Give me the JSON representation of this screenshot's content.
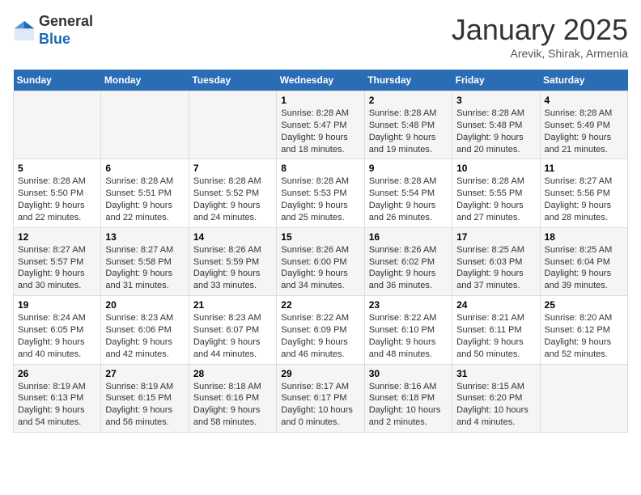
{
  "header": {
    "logo_line1": "General",
    "logo_line2": "Blue",
    "title": "January 2025",
    "subtitle": "Arevik, Shirak, Armenia"
  },
  "weekdays": [
    "Sunday",
    "Monday",
    "Tuesday",
    "Wednesday",
    "Thursday",
    "Friday",
    "Saturday"
  ],
  "weeks": [
    [
      {
        "day": null,
        "info": null
      },
      {
        "day": null,
        "info": null
      },
      {
        "day": null,
        "info": null
      },
      {
        "day": "1",
        "info": "Sunrise: 8:28 AM\nSunset: 5:47 PM\nDaylight: 9 hours\nand 18 minutes."
      },
      {
        "day": "2",
        "info": "Sunrise: 8:28 AM\nSunset: 5:48 PM\nDaylight: 9 hours\nand 19 minutes."
      },
      {
        "day": "3",
        "info": "Sunrise: 8:28 AM\nSunset: 5:48 PM\nDaylight: 9 hours\nand 20 minutes."
      },
      {
        "day": "4",
        "info": "Sunrise: 8:28 AM\nSunset: 5:49 PM\nDaylight: 9 hours\nand 21 minutes."
      }
    ],
    [
      {
        "day": "5",
        "info": "Sunrise: 8:28 AM\nSunset: 5:50 PM\nDaylight: 9 hours\nand 22 minutes."
      },
      {
        "day": "6",
        "info": "Sunrise: 8:28 AM\nSunset: 5:51 PM\nDaylight: 9 hours\nand 22 minutes."
      },
      {
        "day": "7",
        "info": "Sunrise: 8:28 AM\nSunset: 5:52 PM\nDaylight: 9 hours\nand 24 minutes."
      },
      {
        "day": "8",
        "info": "Sunrise: 8:28 AM\nSunset: 5:53 PM\nDaylight: 9 hours\nand 25 minutes."
      },
      {
        "day": "9",
        "info": "Sunrise: 8:28 AM\nSunset: 5:54 PM\nDaylight: 9 hours\nand 26 minutes."
      },
      {
        "day": "10",
        "info": "Sunrise: 8:28 AM\nSunset: 5:55 PM\nDaylight: 9 hours\nand 27 minutes."
      },
      {
        "day": "11",
        "info": "Sunrise: 8:27 AM\nSunset: 5:56 PM\nDaylight: 9 hours\nand 28 minutes."
      }
    ],
    [
      {
        "day": "12",
        "info": "Sunrise: 8:27 AM\nSunset: 5:57 PM\nDaylight: 9 hours\nand 30 minutes."
      },
      {
        "day": "13",
        "info": "Sunrise: 8:27 AM\nSunset: 5:58 PM\nDaylight: 9 hours\nand 31 minutes."
      },
      {
        "day": "14",
        "info": "Sunrise: 8:26 AM\nSunset: 5:59 PM\nDaylight: 9 hours\nand 33 minutes."
      },
      {
        "day": "15",
        "info": "Sunrise: 8:26 AM\nSunset: 6:00 PM\nDaylight: 9 hours\nand 34 minutes."
      },
      {
        "day": "16",
        "info": "Sunrise: 8:26 AM\nSunset: 6:02 PM\nDaylight: 9 hours\nand 36 minutes."
      },
      {
        "day": "17",
        "info": "Sunrise: 8:25 AM\nSunset: 6:03 PM\nDaylight: 9 hours\nand 37 minutes."
      },
      {
        "day": "18",
        "info": "Sunrise: 8:25 AM\nSunset: 6:04 PM\nDaylight: 9 hours\nand 39 minutes."
      }
    ],
    [
      {
        "day": "19",
        "info": "Sunrise: 8:24 AM\nSunset: 6:05 PM\nDaylight: 9 hours\nand 40 minutes."
      },
      {
        "day": "20",
        "info": "Sunrise: 8:23 AM\nSunset: 6:06 PM\nDaylight: 9 hours\nand 42 minutes."
      },
      {
        "day": "21",
        "info": "Sunrise: 8:23 AM\nSunset: 6:07 PM\nDaylight: 9 hours\nand 44 minutes."
      },
      {
        "day": "22",
        "info": "Sunrise: 8:22 AM\nSunset: 6:09 PM\nDaylight: 9 hours\nand 46 minutes."
      },
      {
        "day": "23",
        "info": "Sunrise: 8:22 AM\nSunset: 6:10 PM\nDaylight: 9 hours\nand 48 minutes."
      },
      {
        "day": "24",
        "info": "Sunrise: 8:21 AM\nSunset: 6:11 PM\nDaylight: 9 hours\nand 50 minutes."
      },
      {
        "day": "25",
        "info": "Sunrise: 8:20 AM\nSunset: 6:12 PM\nDaylight: 9 hours\nand 52 minutes."
      }
    ],
    [
      {
        "day": "26",
        "info": "Sunrise: 8:19 AM\nSunset: 6:13 PM\nDaylight: 9 hours\nand 54 minutes."
      },
      {
        "day": "27",
        "info": "Sunrise: 8:19 AM\nSunset: 6:15 PM\nDaylight: 9 hours\nand 56 minutes."
      },
      {
        "day": "28",
        "info": "Sunrise: 8:18 AM\nSunset: 6:16 PM\nDaylight: 9 hours\nand 58 minutes."
      },
      {
        "day": "29",
        "info": "Sunrise: 8:17 AM\nSunset: 6:17 PM\nDaylight: 10 hours\nand 0 minutes."
      },
      {
        "day": "30",
        "info": "Sunrise: 8:16 AM\nSunset: 6:18 PM\nDaylight: 10 hours\nand 2 minutes."
      },
      {
        "day": "31",
        "info": "Sunrise: 8:15 AM\nSunset: 6:20 PM\nDaylight: 10 hours\nand 4 minutes."
      },
      {
        "day": null,
        "info": null
      }
    ]
  ]
}
